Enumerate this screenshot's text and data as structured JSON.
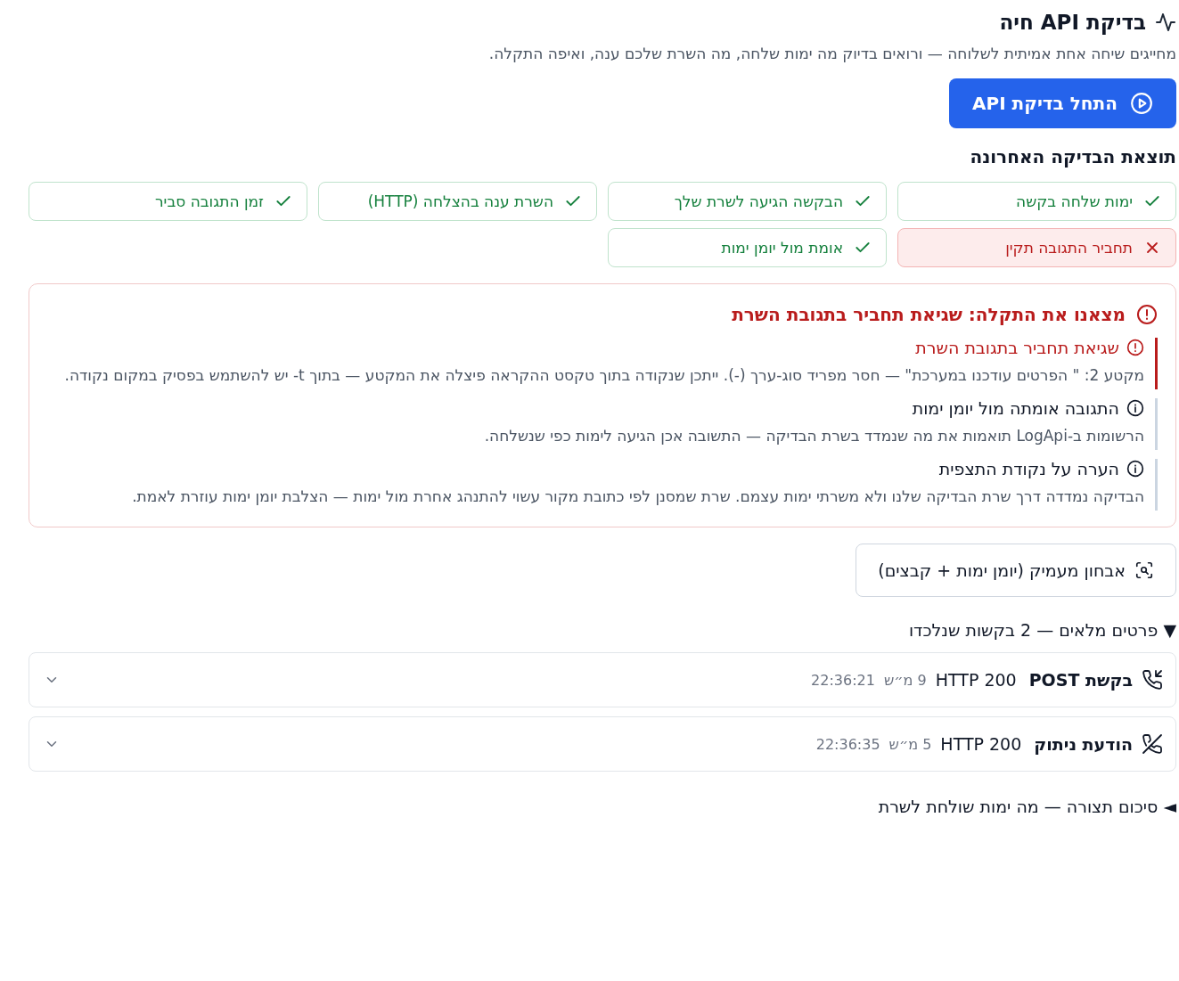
{
  "header": {
    "title": "בדיקת API חיה",
    "subtitle": "מחייגים שיחה אחת אמיתית לשלוחה — ורואים בדיוק מה ימות שלחה, מה השרת שלכם ענה, ואיפה התקלה."
  },
  "start_button": {
    "label": "התחל בדיקת API"
  },
  "result": {
    "title": "תוצאת הבדיקה האחרונה",
    "checks": [
      {
        "label": "ימות שלחה בקשה",
        "passed": true
      },
      {
        "label": "הבקשה הגיעה לשרת שלך",
        "passed": true
      },
      {
        "label": "השרת ענה בהצלחה (HTTP)",
        "passed": true
      },
      {
        "label": "זמן התגובה סביר",
        "passed": true
      },
      {
        "label": "תחביר התגובה תקין",
        "passed": false
      },
      {
        "label": "אומת מול יומן ימות",
        "passed": true
      }
    ]
  },
  "issues": {
    "title": "מצאנו את התקלה: שגיאת תחביר בתגובת השרת",
    "items": [
      {
        "kind": "error",
        "title": "שגיאת תחביר בתגובת השרת",
        "text": "מקטע 2: \" הפרטים עודכנו במערכת\" — חסר מפריד סוג-ערך (-). ייתכן שנקודה בתוך טקסט ההקראה פיצלה את המקטע — בתוך t- יש להשתמש בפסיק במקום נקודה."
      },
      {
        "kind": "info",
        "title": "התגובה אומתה מול יומן ימות",
        "text": "הרשומות ב-LogApi תואמות את מה שנמדד בשרת הבדיקה — התשובה אכן הגיעה לימות כפי שנשלחה."
      },
      {
        "kind": "info",
        "title": "הערה על נקודת התצפית",
        "text": "הבדיקה נמדדה דרך שרת הבדיקה שלנו ולא משרתי ימות עצמם. שרת שמסנן לפי כתובת מקור עשוי להתנהג אחרת מול ימות — הצלבת יומן ימות עוזרת לאמת."
      }
    ]
  },
  "diagnose_button": {
    "label": "אבחון מעמיק (יומן ימות + קבצים)"
  },
  "details": {
    "marker": "▼",
    "title": "פרטים מלאים — 2 בקשות שנלכדו",
    "requests": [
      {
        "kind": "request",
        "title": "בקשת POST",
        "status": "HTTP 200",
        "duration": "9 מ״ש",
        "time": "22:36:21"
      },
      {
        "kind": "hangup",
        "title": "הודעת ניתוק",
        "status": "HTTP 200",
        "duration": "5 מ״ש",
        "time": "22:36:35"
      }
    ]
  },
  "summary": {
    "marker": "◄",
    "title": "סיכום תצורה — מה ימות שולחת לשרת"
  }
}
